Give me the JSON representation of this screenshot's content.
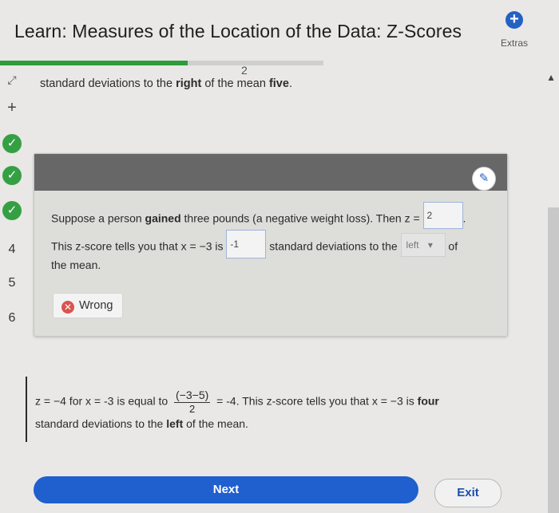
{
  "header": {
    "title": "Learn: Measures of the Location of the Data: Z-Scores",
    "extras_label": "Extras",
    "progress_fraction": 0.58
  },
  "sidenav": {
    "items": [
      {
        "type": "expand-icon",
        "text": "⤢"
      },
      {
        "type": "plus",
        "text": "+"
      },
      {
        "type": "check",
        "text": "✓"
      },
      {
        "type": "check",
        "text": "✓"
      },
      {
        "type": "check",
        "text": "✓"
      },
      {
        "type": "number",
        "text": "4"
      },
      {
        "type": "number",
        "text": "5"
      },
      {
        "type": "number",
        "text": "6"
      }
    ]
  },
  "stray_fragment": "2",
  "previous_line": {
    "prefix": "standard deviations to the ",
    "bold1": "right",
    "mid": " of the mean ",
    "bold2": "five",
    "end": "."
  },
  "question": {
    "line1_prefix": "Suppose a person ",
    "line1_bold": "gained",
    "line1_suffix": " three pounds (a negative weight loss). Then z = ",
    "answer_z": "2",
    "line1_end": ".",
    "line2_prefix": "This z-score tells you that x = −3 is ",
    "answer_sd": "-1",
    "line2_mid": " standard deviations to the ",
    "dropdown_value": "left",
    "line2_end": " of",
    "line3": "the mean.",
    "feedback": "Wrong"
  },
  "explanation": {
    "row1_prefix": "z = −4 for x = -3 is equal to ",
    "frac_num": "(−3−5)",
    "frac_den": "2",
    "row1_mid": " = -4. This z-score tells you that x = −3 is ",
    "row1_bold": "four",
    "row2_prefix": "standard deviations to the ",
    "row2_bold": "left",
    "row2_suffix": " of the mean."
  },
  "buttons": {
    "next": "Next",
    "exit": "Exit"
  },
  "colors": {
    "accent_blue": "#1f5fce",
    "success_green": "#34a043",
    "error_red": "#d9534f"
  }
}
